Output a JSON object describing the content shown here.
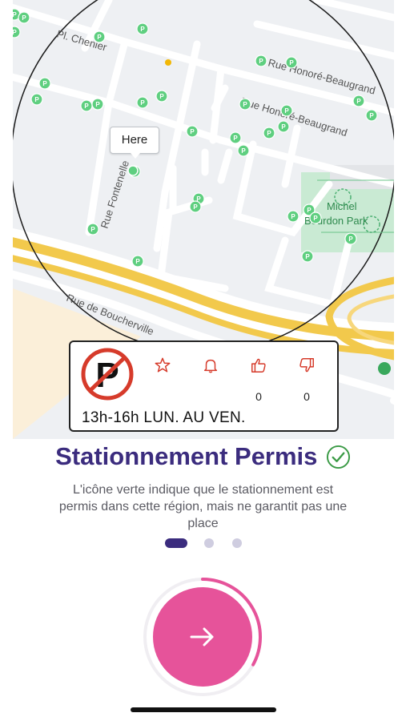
{
  "map": {
    "here_label": "Here",
    "streets": {
      "pl_chenier": "Pl. Chenier",
      "rue_honore_beaugrand_1": "Rue Honoré-Beaugrand",
      "rue_honore_beaugrand_2": "Rue Honoré-Beaugrand",
      "rue_fontenelle": "Rue Fontenelle",
      "rue_de_boucherville": "Rue de Boucherville"
    },
    "park": {
      "line1": "Michel",
      "line2": "Bourdon Park"
    },
    "marker_letter": "P",
    "colors": {
      "marker": "#5fcf80",
      "radius_circle": "#1a1a1a",
      "highway": "#f2c94c",
      "park": "#c9ead3"
    }
  },
  "info_card": {
    "sign_letter": "P",
    "icons": [
      "star-icon",
      "bell-icon",
      "thumbs-up-icon",
      "thumbs-down-icon"
    ],
    "likes": "0",
    "dislikes": "0",
    "hours": "13h-16h LUN. AU VEN.",
    "accent_color": "#d63b2b"
  },
  "onboarding": {
    "title": "Stationnement Permis",
    "description": "L'icône verte indique que le stationnement est permis dans cette région, mais ne garantit pas une place",
    "page_index": 1,
    "page_count": 3,
    "progress": 0.33,
    "colors": {
      "title": "#3b2c7e",
      "button": "#e6539a",
      "check": "#3a9a45"
    }
  }
}
